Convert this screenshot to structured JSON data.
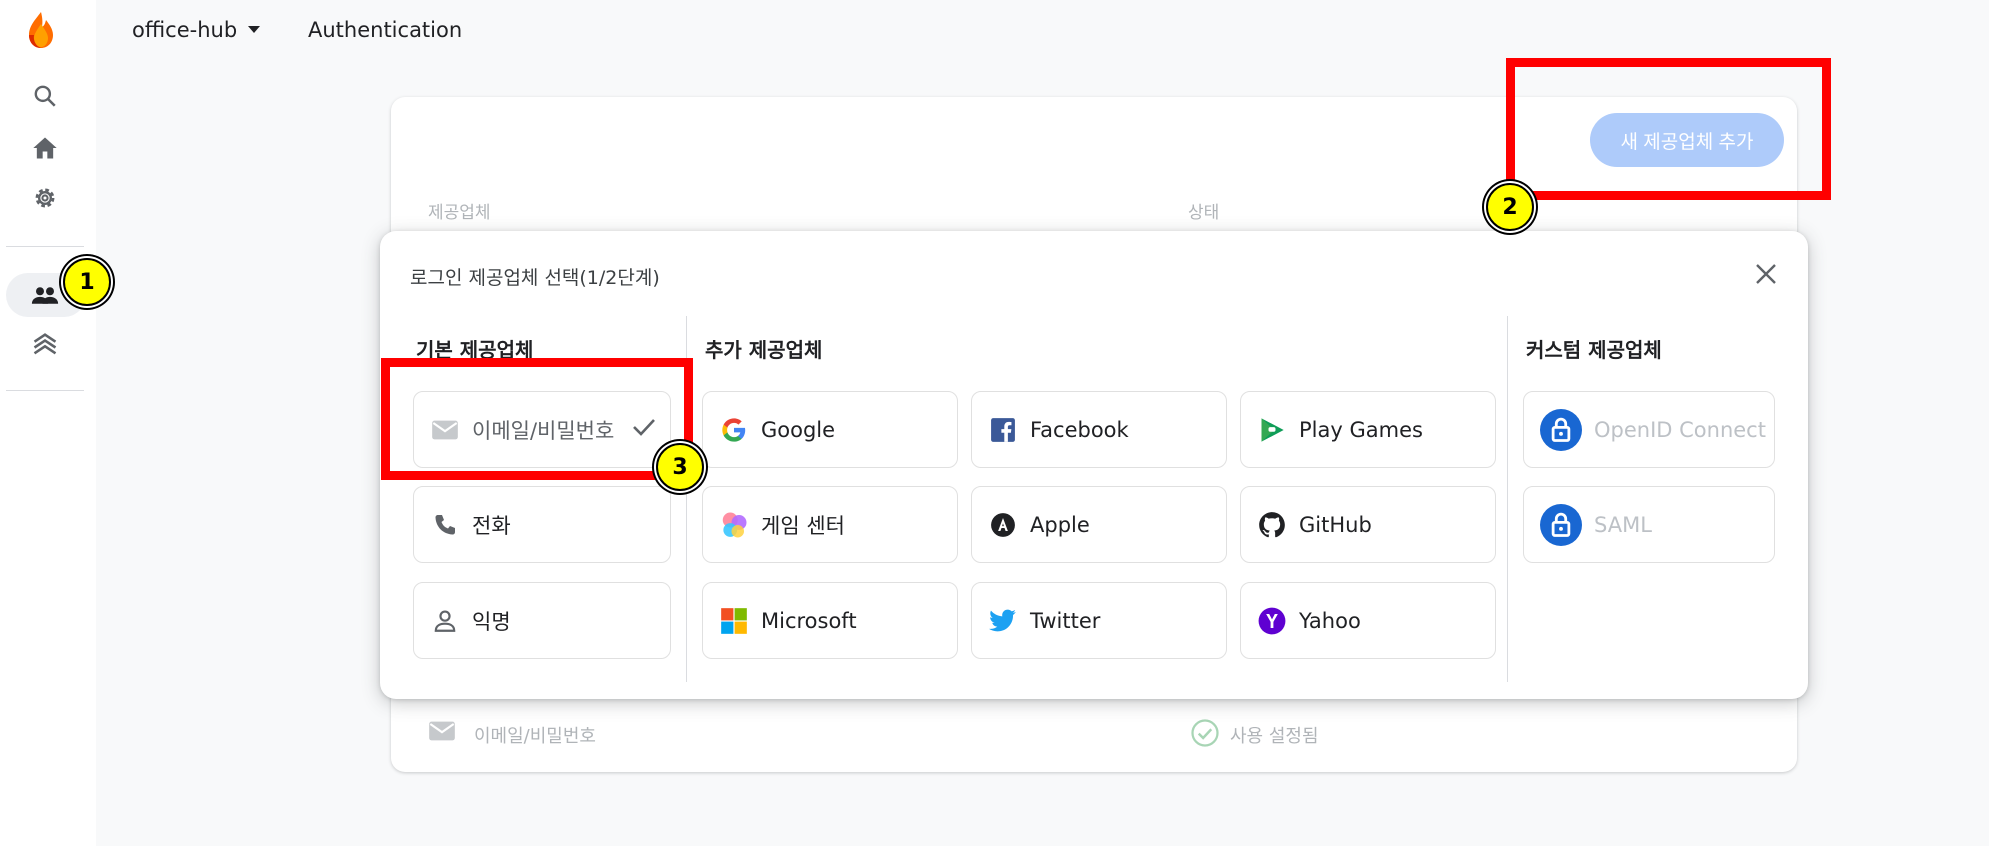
{
  "topbar": {
    "project": "office-hub",
    "breadcrumb": "Authentication"
  },
  "card": {
    "add_provider_button": "새 제공업체 추가",
    "col_provider": "제공업체",
    "col_status": "상태",
    "row": {
      "provider": "이메일/비밀번호",
      "status": "사용 설정됨"
    }
  },
  "modal": {
    "title": "로그인 제공업체 선택(1/2단계)",
    "sections": {
      "basic": "기본 제공업체",
      "additional": "추가 제공업체",
      "custom": "커스텀 제공업체"
    },
    "basic": [
      "이메일/비밀번호",
      "전화",
      "익명"
    ],
    "additional": [
      "Google",
      "Facebook",
      "Play Games",
      "게임 센터",
      "Apple",
      "GitHub",
      "Microsoft",
      "Twitter",
      "Yahoo"
    ],
    "custom": [
      "OpenID Connect",
      "SAML"
    ]
  },
  "annotations": [
    "1",
    "2",
    "3"
  ],
  "colors": {
    "accent": "#1a73e8",
    "button_disabled": "#aecbfa",
    "annotation_red": "#ff0000",
    "annotation_yellow": "#ffff00"
  }
}
